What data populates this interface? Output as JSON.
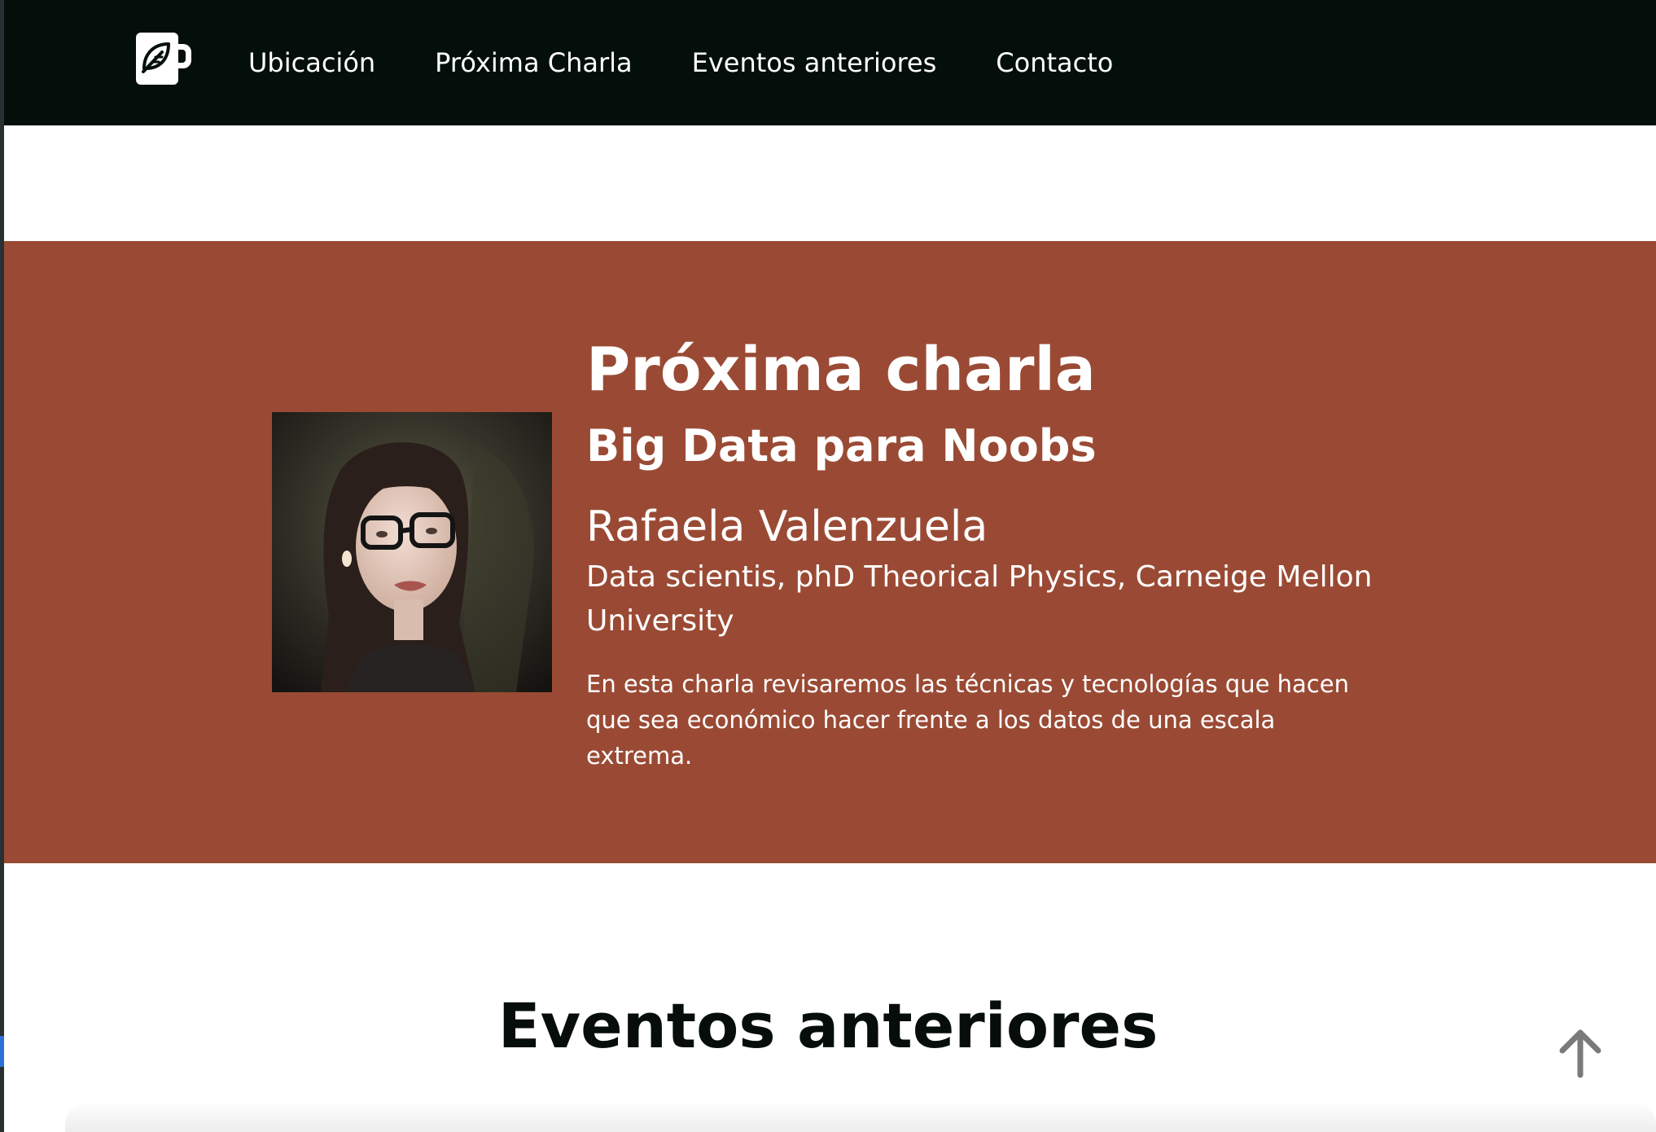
{
  "nav": {
    "logo_icon": "mug-leaf-icon",
    "links": [
      {
        "label": "Ubicación"
      },
      {
        "label": "Próxima Charla"
      },
      {
        "label": "Eventos anteriores"
      },
      {
        "label": "Contacto"
      }
    ]
  },
  "next_talk": {
    "heading": "Próxima charla",
    "title": "Big Data para Noobs",
    "speaker_name": "Rafaela Valenzuela",
    "speaker_role": "Data scientis, phD Theorical Physics, Carneige Mellon University",
    "description": "En esta charla revisaremos las técnicas y tecnologías que hacen que sea económico hacer frente a los datos de una escala extrema."
  },
  "past_events": {
    "heading": "Eventos anteriores"
  },
  "scroll_top_icon": "arrow-up-icon",
  "colors": {
    "navbar_bg": "#040f0c",
    "hero_bg": "#9a4a34",
    "text_light": "#ffffff",
    "text_dark": "#060d0b",
    "scroll_icon": "#7a7a7a"
  }
}
